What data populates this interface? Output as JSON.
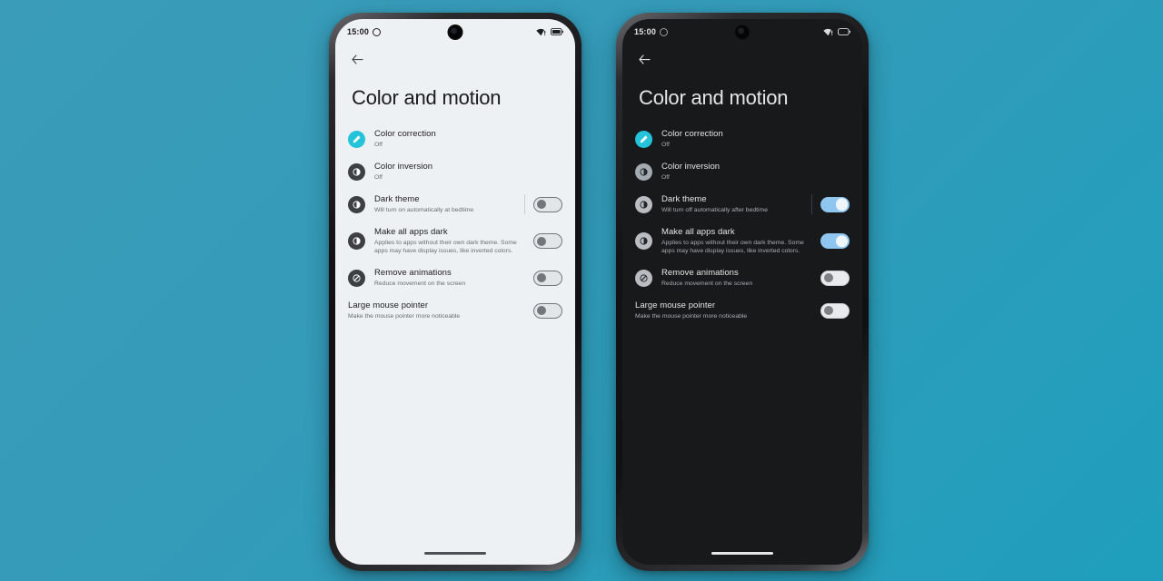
{
  "background": {
    "color_top_left": "#3a9cb8",
    "color_bottom_right": "#1f9fbd"
  },
  "phones": [
    {
      "theme": "light",
      "status_bar": {
        "time": "15:00",
        "alarm_icon": "alarm-icon",
        "wifi_icon": "wifi-icon",
        "battery_icon": "battery-icon"
      },
      "app_bar": {
        "back_icon": "back-arrow-icon"
      },
      "title": "Color and motion",
      "rows": [
        {
          "icon": "color-correction-icon",
          "icon_style": "accent",
          "title": "Color correction",
          "subtitle": "Off",
          "control": "none"
        },
        {
          "icon": "color-inversion-icon",
          "icon_style": "normal",
          "title": "Color inversion",
          "subtitle": "Off",
          "control": "none"
        },
        {
          "icon": "dark-theme-icon",
          "icon_style": "normal",
          "title": "Dark theme",
          "subtitle": "Will turn on automatically at bedtime",
          "control": "switch",
          "switch_state": "off",
          "divider": true
        },
        {
          "icon": "make-all-apps-dark-icon",
          "icon_style": "normal",
          "title": "Make all apps dark",
          "subtitle": "Applies to apps without their own dark theme. Some apps may have display issues, like inverted colors.",
          "control": "switch",
          "switch_state": "off",
          "divider": false
        },
        {
          "icon": "remove-animations-icon",
          "icon_style": "normal",
          "title": "Remove animations",
          "subtitle": "Reduce movement on the screen",
          "control": "switch",
          "switch_state": "off",
          "divider": false
        },
        {
          "icon": "none",
          "icon_style": "none",
          "title": "Large mouse pointer",
          "subtitle": "Make the mouse pointer more noticeable",
          "control": "switch",
          "switch_state": "off",
          "divider": false
        }
      ]
    },
    {
      "theme": "dark",
      "status_bar": {
        "time": "15:00",
        "alarm_icon": "alarm-icon",
        "wifi_icon": "wifi-icon",
        "battery_icon": "battery-icon"
      },
      "app_bar": {
        "back_icon": "back-arrow-icon"
      },
      "title": "Color and motion",
      "rows": [
        {
          "icon": "color-correction-icon",
          "icon_style": "accent",
          "title": "Color correction",
          "subtitle": "Off",
          "control": "none"
        },
        {
          "icon": "color-inversion-icon",
          "icon_style": "normal",
          "title": "Color inversion",
          "subtitle": "Off",
          "control": "none"
        },
        {
          "icon": "dark-theme-icon",
          "icon_style": "normal",
          "title": "Dark theme",
          "subtitle": "Will turn off automatically after bedtime",
          "control": "switch",
          "switch_state": "on",
          "divider": true
        },
        {
          "icon": "make-all-apps-dark-icon",
          "icon_style": "normal",
          "title": "Make all apps dark",
          "subtitle": "Applies to apps without their own dark theme. Some apps may have display issues, like inverted colors.",
          "control": "switch",
          "switch_state": "on",
          "divider": false
        },
        {
          "icon": "remove-animations-icon",
          "icon_style": "normal",
          "title": "Remove animations",
          "subtitle": "Reduce movement on the screen",
          "control": "switch",
          "switch_state": "off",
          "divider": false
        },
        {
          "icon": "none",
          "icon_style": "none",
          "title": "Large mouse pointer",
          "subtitle": "Make the mouse pointer more noticeable",
          "control": "switch",
          "switch_state": "off",
          "divider": false
        }
      ]
    }
  ],
  "colors": {
    "accent_cyan": "#25c3d9",
    "switch_on": "#8ec6f0",
    "icon_dark_circle": "#3c4043",
    "icon_light_circle": "#b9bdc1"
  }
}
